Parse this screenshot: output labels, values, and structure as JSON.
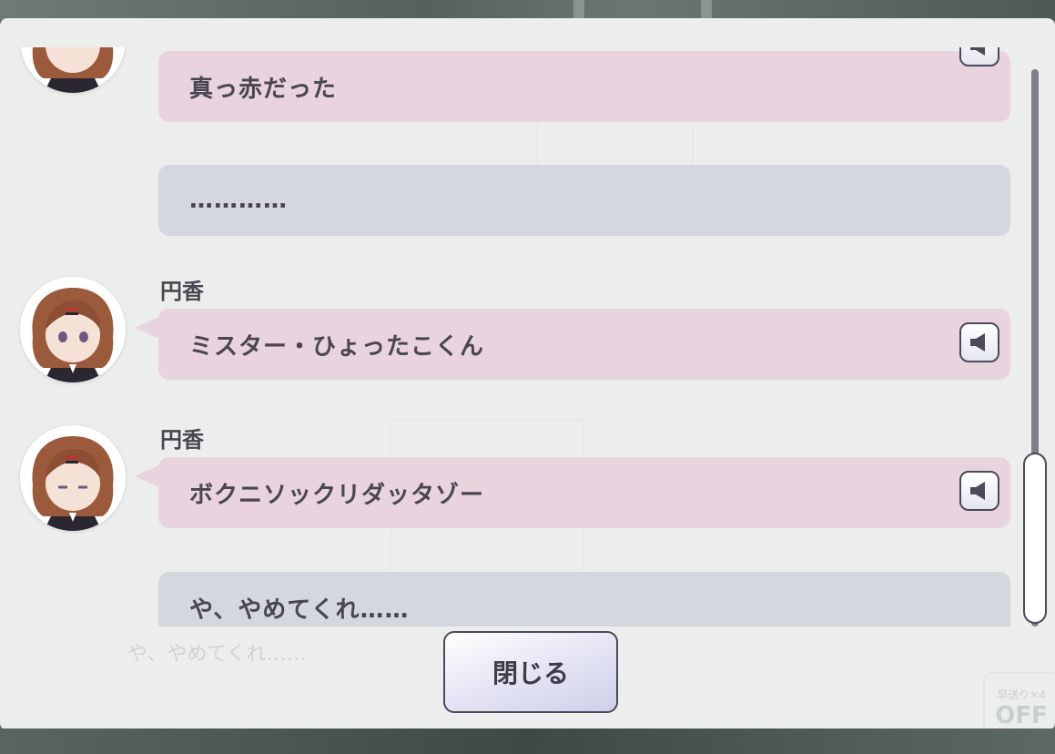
{
  "log": {
    "entries": [
      {
        "speaker": "",
        "text": "真っ赤だった",
        "tone": "pink",
        "has_voice": true
      },
      {
        "speaker": "",
        "text": "…………",
        "tone": "gray",
        "has_voice": false
      },
      {
        "speaker": "円香",
        "text": "ミスター・ひょったこくん",
        "tone": "pink",
        "has_voice": true
      },
      {
        "speaker": "円香",
        "text": "ボクニソックリダッタゾー",
        "tone": "pink",
        "has_voice": true
      },
      {
        "speaker": "",
        "text": "や、やめてくれ……",
        "tone": "gray",
        "has_voice": false
      }
    ]
  },
  "background": {
    "dialogue_text": "や、やめてくれ……",
    "fast_forward_label": "早送り×4",
    "fast_forward_state": "OFF"
  },
  "close_button": {
    "label": "閉じる"
  },
  "colors": {
    "bubble_pink": "#e8d3de",
    "bubble_gray": "#d3d8df",
    "outline": "#4b4a58",
    "text": "#4a4650"
  },
  "icons": {
    "voice": "speaker-icon",
    "avatar": "madoka-avatar"
  }
}
